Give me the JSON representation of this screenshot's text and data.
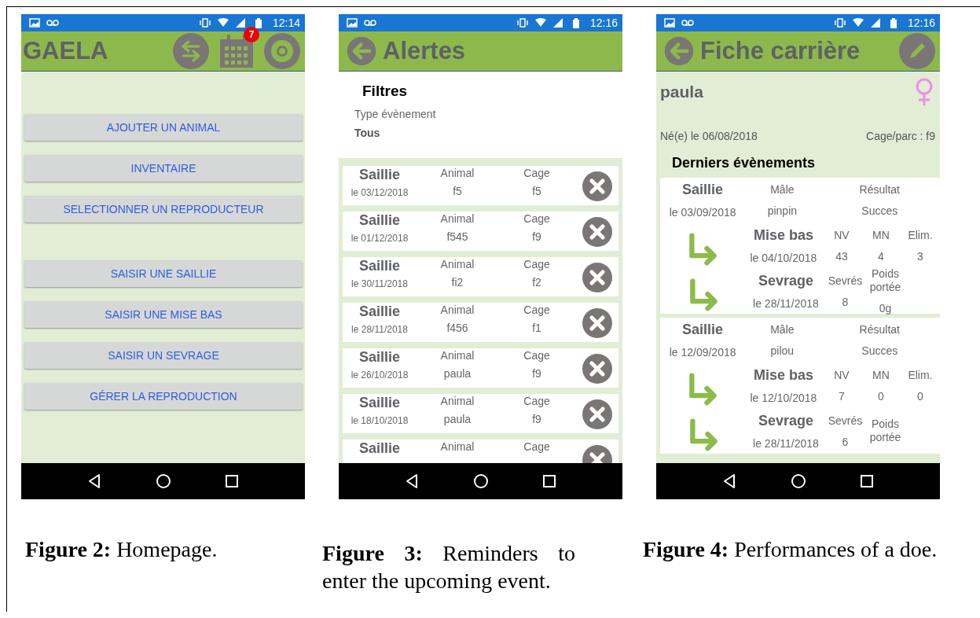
{
  "figures": [
    {
      "kind": "home",
      "status_bar": {
        "time": "12:14"
      },
      "app_bar": {
        "title": "GAELA",
        "badge": "7"
      },
      "button_groups": [
        [
          "AJOUTER UN ANIMAL",
          "INVENTAIRE",
          "SELECTIONNER UN REPRODUCTEUR"
        ],
        [
          "SAISIR UNE SAILLIE",
          "SAISIR UNE MISE BAS",
          "SAISIR UN SEVRAGE",
          "GÉRER LA REPRODUCTION"
        ]
      ],
      "caption": "**Figure 2:** Homepage."
    },
    {
      "kind": "alerts",
      "status_bar": {
        "time": "12:16"
      },
      "app_bar": {
        "title": "Alertes"
      },
      "filters": {
        "title": "Filtres",
        "label": "Type évènement",
        "value": "Tous"
      },
      "alerts": [
        {
          "title": "Saillie",
          "date": "le 03/12/2018",
          "fields": [
            {
              "label": "Animal",
              "value": "f5"
            },
            {
              "label": "Cage",
              "value": "f5"
            }
          ]
        },
        {
          "title": "Saillie",
          "date": "le 01/12/2018",
          "fields": [
            {
              "label": "Animal",
              "value": "f545"
            },
            {
              "label": "Cage",
              "value": "f9"
            }
          ]
        },
        {
          "title": "Saillie",
          "date": "le 30/11/2018",
          "fields": [
            {
              "label": "Animal",
              "value": "fi2"
            },
            {
              "label": "Cage",
              "value": "f2"
            }
          ]
        },
        {
          "title": "Saillie",
          "date": "le 28/11/2018",
          "fields": [
            {
              "label": "Animal",
              "value": "f456"
            },
            {
              "label": "Cage",
              "value": "f1"
            }
          ]
        },
        {
          "title": "Saillie",
          "date": "le 26/10/2018",
          "fields": [
            {
              "label": "Animal",
              "value": "paula"
            },
            {
              "label": "Cage",
              "value": "f9"
            }
          ]
        },
        {
          "title": "Saillie",
          "date": "le 18/10/2018",
          "fields": [
            {
              "label": "Animal",
              "value": "paula"
            },
            {
              "label": "Cage",
              "value": "f9"
            }
          ]
        },
        {
          "title": "Saillie",
          "fields": [
            {
              "label": "Animal"
            },
            {
              "label": "Cage"
            }
          ]
        }
      ],
      "caption": "**Figure 3:** Reminders to enter the upcoming event."
    },
    {
      "kind": "career",
      "status_bar": {
        "time": "12:16"
      },
      "app_bar": {
        "title": "Fiche carrière"
      },
      "animal": {
        "name": "paula",
        "birth": "Né(e) le 06/08/2018",
        "cage": "Cage/parc : f9"
      },
      "section_title": "Derniers évènements",
      "cycles": [
        {
          "events": [
            {
              "kind": "mating",
              "title": "Saillie",
              "date": "le 03/09/2018",
              "fields": [
                {
                  "label": "Mâle",
                  "value": "pinpin"
                },
                {
                  "label": "Résultat",
                  "value": "Succes"
                }
              ]
            },
            {
              "kind": "follow_up",
              "title": "Mise bas",
              "date": "le 04/10/2018",
              "fields": [
                {
                  "label": "NV",
                  "value": "43"
                },
                {
                  "label": "MN",
                  "value": "4"
                },
                {
                  "label": "Elim.",
                  "value": "3"
                }
              ]
            },
            {
              "kind": "follow_up",
              "title": "Sevrage",
              "date": "le 28/11/2018",
              "fields": [
                {
                  "label": "Sevrés",
                  "value": "8"
                },
                {
                  "label": "Poids portée",
                  "value": "0g"
                }
              ]
            }
          ]
        },
        {
          "events": [
            {
              "kind": "mating",
              "title": "Saillie",
              "date": "le 12/09/2018",
              "fields": [
                {
                  "label": "Mâle",
                  "value": "pilou"
                },
                {
                  "label": "Résultat",
                  "value": "Succes"
                }
              ]
            },
            {
              "kind": "follow_up",
              "title": "Mise bas",
              "date": "le 12/10/2018",
              "fields": [
                {
                  "label": "NV",
                  "value": "7"
                },
                {
                  "label": "MN",
                  "value": "0"
                },
                {
                  "label": "Elim.",
                  "value": "0"
                }
              ]
            },
            {
              "kind": "follow_up",
              "title": "Sevrage",
              "date": "le 28/11/2018",
              "fields": [
                {
                  "label": "Sevrés",
                  "value": "6"
                },
                {
                  "label": "Poids portée"
                }
              ]
            }
          ]
        }
      ],
      "caption": "**Figure 4:** Performances of a doe."
    }
  ]
}
